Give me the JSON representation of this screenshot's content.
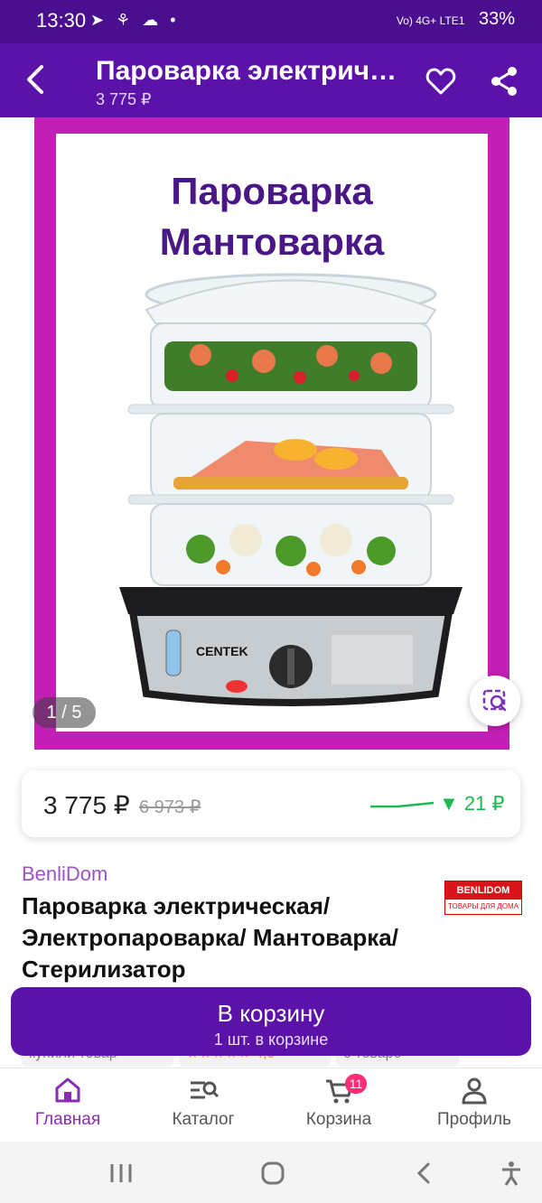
{
  "status_bar": {
    "time": "13:30",
    "left_icons": "➤ ⚘ ☁ •",
    "network": "Vo) 4G+ LTE1",
    "battery": "33%"
  },
  "header": {
    "title": "Пароварка электрич…",
    "price": "3 775 ₽"
  },
  "gallery": {
    "image_title_line1": "Пароварка",
    "image_title_line2": "Мантоварка",
    "product_brand_on_device": "CENTEK",
    "counter": "1 / 5"
  },
  "price_card": {
    "current": "3 775 ₽",
    "old": "6 973 ₽",
    "delta": "▼ 21 ₽",
    "trend_color": "#1db954"
  },
  "product": {
    "brand": "BenliDom",
    "title": "Пароварка электрическая/ Электропароварка/ Мантоварка/Стерилизатор",
    "logo_top": "BENLIDOM",
    "logo_bottom": "ТОВАРЫ ДЛЯ ДОМА"
  },
  "chips": [
    "купили товар",
    "★★★★★ 4,9",
    "о товаре"
  ],
  "cart_button": {
    "label": "В корзину",
    "sub": "1 шт. в корзине"
  },
  "bottom_nav": {
    "items": [
      {
        "label": "Главная",
        "icon": "home-icon",
        "active": true
      },
      {
        "label": "Каталог",
        "icon": "catalog-search-icon",
        "active": false
      },
      {
        "label": "Корзина",
        "icon": "cart-icon",
        "active": false
      },
      {
        "label": "Профиль",
        "icon": "profile-icon",
        "active": false
      }
    ],
    "cart_badge": "11"
  },
  "colors": {
    "brand_purple": "#5b12a8",
    "frame_magenta": "#c21fb5",
    "accent_link": "#a050c8",
    "badge_pink": "#ff2f74"
  }
}
